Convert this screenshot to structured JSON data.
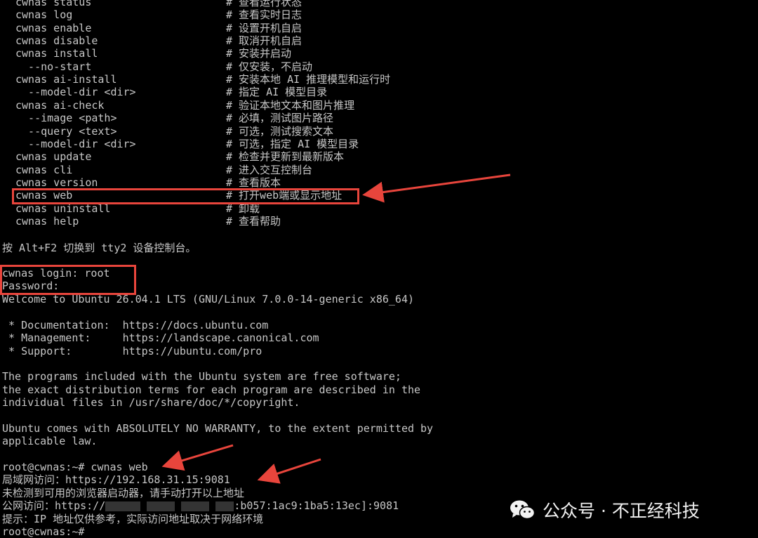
{
  "terminal": {
    "help_rows": [
      {
        "cmd": "cwnas status",
        "desc": "# 查看运行状态"
      },
      {
        "cmd": "cwnas log",
        "desc": "# 查看实时日志"
      },
      {
        "cmd": "cwnas enable",
        "desc": "# 设置开机自启"
      },
      {
        "cmd": "cwnas disable",
        "desc": "# 取消开机自启"
      },
      {
        "cmd": "cwnas install",
        "desc": "# 安装并启动"
      },
      {
        "cmd": "  --no-start",
        "desc": "# 仅安装，不启动"
      },
      {
        "cmd": "cwnas ai-install",
        "desc": "# 安装本地 AI 推理模型和运行时"
      },
      {
        "cmd": "  --model-dir <dir>",
        "desc": "# 指定 AI 模型目录"
      },
      {
        "cmd": "cwnas ai-check",
        "desc": "# 验证本地文本和图片推理"
      },
      {
        "cmd": "  --image <path>",
        "desc": "# 必填，测试图片路径"
      },
      {
        "cmd": "  --query <text>",
        "desc": "# 可选，测试搜索文本"
      },
      {
        "cmd": "  --model-dir <dir>",
        "desc": "# 可选，指定 AI 模型目录"
      },
      {
        "cmd": "cwnas update",
        "desc": "# 检查并更新到最新版本"
      },
      {
        "cmd": "cwnas cli",
        "desc": "# 进入交互控制台"
      },
      {
        "cmd": "cwnas version",
        "desc": "# 查看版本"
      },
      {
        "cmd": "cwnas web",
        "desc": "# 打开web端或显示地址"
      },
      {
        "cmd": "cwnas uninstall",
        "desc": "# 卸载"
      },
      {
        "cmd": "cwnas help",
        "desc": "# 查看帮助"
      }
    ],
    "tty_hint": "按 Alt+F2 切换到 tty2 设备控制台。",
    "login_line": "cwnas login: root",
    "password_line": "Password:",
    "welcome": "Welcome to Ubuntu 26.04.1 LTS (GNU/Linux 7.0.0-14-generic x86_64)",
    "doc_line": " * Documentation:  https://docs.ubuntu.com",
    "mgmt_line": " * Management:     https://landscape.canonical.com",
    "support_line": " * Support:        https://ubuntu.com/pro",
    "programs_1": "The programs included with the Ubuntu system are free software;",
    "programs_2": "the exact distribution terms for each program are described in the",
    "programs_3": "individual files in /usr/share/doc/*/copyright.",
    "warranty_1": "Ubuntu comes with ABSOLUTELY NO WARRANTY, to the extent permitted by",
    "warranty_2": "applicable law.",
    "prompt_cmd": "root@cwnas:~# cwnas web",
    "lan_access": "局域网访问：https://192.168.31.15:9081",
    "no_browser": "未检测到可用的浏览器启动器，请手动打开以上地址",
    "public_prefix": "公网访问：https://",
    "public_suffix": ":b057:1ac9:1ba5:13ec]:9081",
    "ip_note": "提示：IP 地址仅供参考，实际访问地址取决于网络环境",
    "last_prompt": "root@cwnas:~#"
  },
  "watermark": {
    "text": "公众号 · 不正经科技",
    "icon": "wechat-icon"
  },
  "colors": {
    "background": "#000000",
    "text": "#c7c7c7",
    "highlight": "#e8453c"
  }
}
